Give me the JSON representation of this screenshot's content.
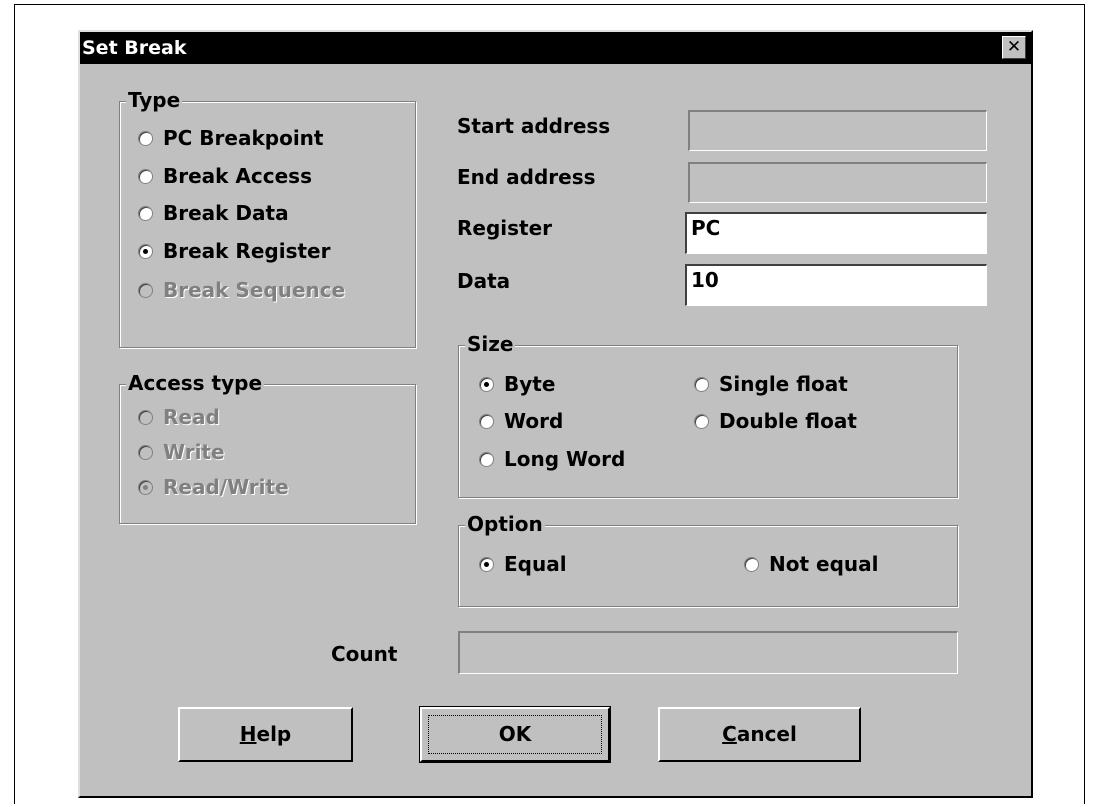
{
  "window": {
    "title": "Set Break",
    "close_glyph": "✕"
  },
  "type_group": {
    "legend": "Type",
    "options": [
      {
        "label": "PC Breakpoint",
        "selected": false,
        "enabled": true
      },
      {
        "label": "Break Access",
        "selected": false,
        "enabled": true
      },
      {
        "label": "Break Data",
        "selected": false,
        "enabled": true
      },
      {
        "label": "Break Register",
        "selected": true,
        "enabled": true
      },
      {
        "label": "Break Sequence",
        "selected": false,
        "enabled": false
      }
    ]
  },
  "access_group": {
    "legend": "Access type",
    "options": [
      {
        "label": "Read",
        "selected": false,
        "enabled": false
      },
      {
        "label": "Write",
        "selected": false,
        "enabled": false
      },
      {
        "label": "Read/Write",
        "selected": true,
        "enabled": false
      }
    ]
  },
  "fields": {
    "start_address": {
      "label": "Start address",
      "value": ""
    },
    "end_address": {
      "label": "End address",
      "value": ""
    },
    "register": {
      "label": "Register",
      "value": "PC"
    },
    "data": {
      "label": "Data",
      "value": "10"
    },
    "count": {
      "label": "Count",
      "value": ""
    }
  },
  "size_group": {
    "legend": "Size",
    "options": [
      {
        "label": "Byte",
        "selected": true
      },
      {
        "label": "Word",
        "selected": false
      },
      {
        "label": "Long Word",
        "selected": false
      },
      {
        "label": "Single float",
        "selected": false
      },
      {
        "label": "Double float",
        "selected": false
      }
    ]
  },
  "option_group": {
    "legend": "Option",
    "options": [
      {
        "label": "Equal",
        "selected": true
      },
      {
        "label": "Not equal",
        "selected": false
      }
    ]
  },
  "buttons": {
    "help": {
      "mnemonic": "H",
      "rest": "elp"
    },
    "ok": {
      "label": "OK"
    },
    "cancel": {
      "mnemonic": "C",
      "rest": "ancel"
    }
  }
}
